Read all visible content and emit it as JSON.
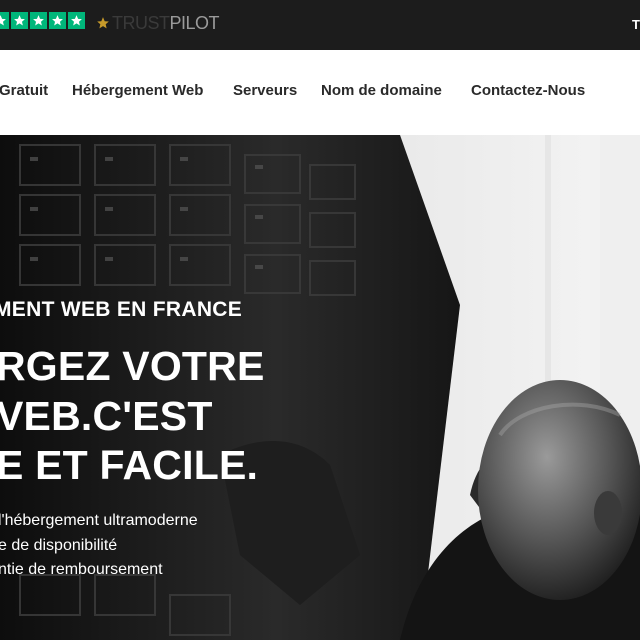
{
  "topbar": {
    "rating_stars": 5,
    "star_color": "#00b67a",
    "logo_text_a": "TRUST",
    "logo_text_b": "PILOT",
    "right_text": "T"
  },
  "nav": {
    "items": [
      {
        "label": "Gratuit"
      },
      {
        "label": "Hébergement Web"
      },
      {
        "label": "Serveurs"
      },
      {
        "label": "Nom de domaine"
      },
      {
        "label": "Contactez-Nous"
      }
    ]
  },
  "hero": {
    "kicker": "MENT WEB EN FRANCE",
    "headline": [
      "RGEZ VOTRE",
      "VEB.C'EST",
      "E ET FACILE."
    ],
    "features": [
      "l'hébergement ultramoderne",
      "e de disponibilité",
      "ntie de remboursement"
    ]
  },
  "colors": {
    "topbar_bg": "#1c1c1c",
    "nav_text": "#2a2a2a",
    "hero_text": "#ffffff"
  }
}
